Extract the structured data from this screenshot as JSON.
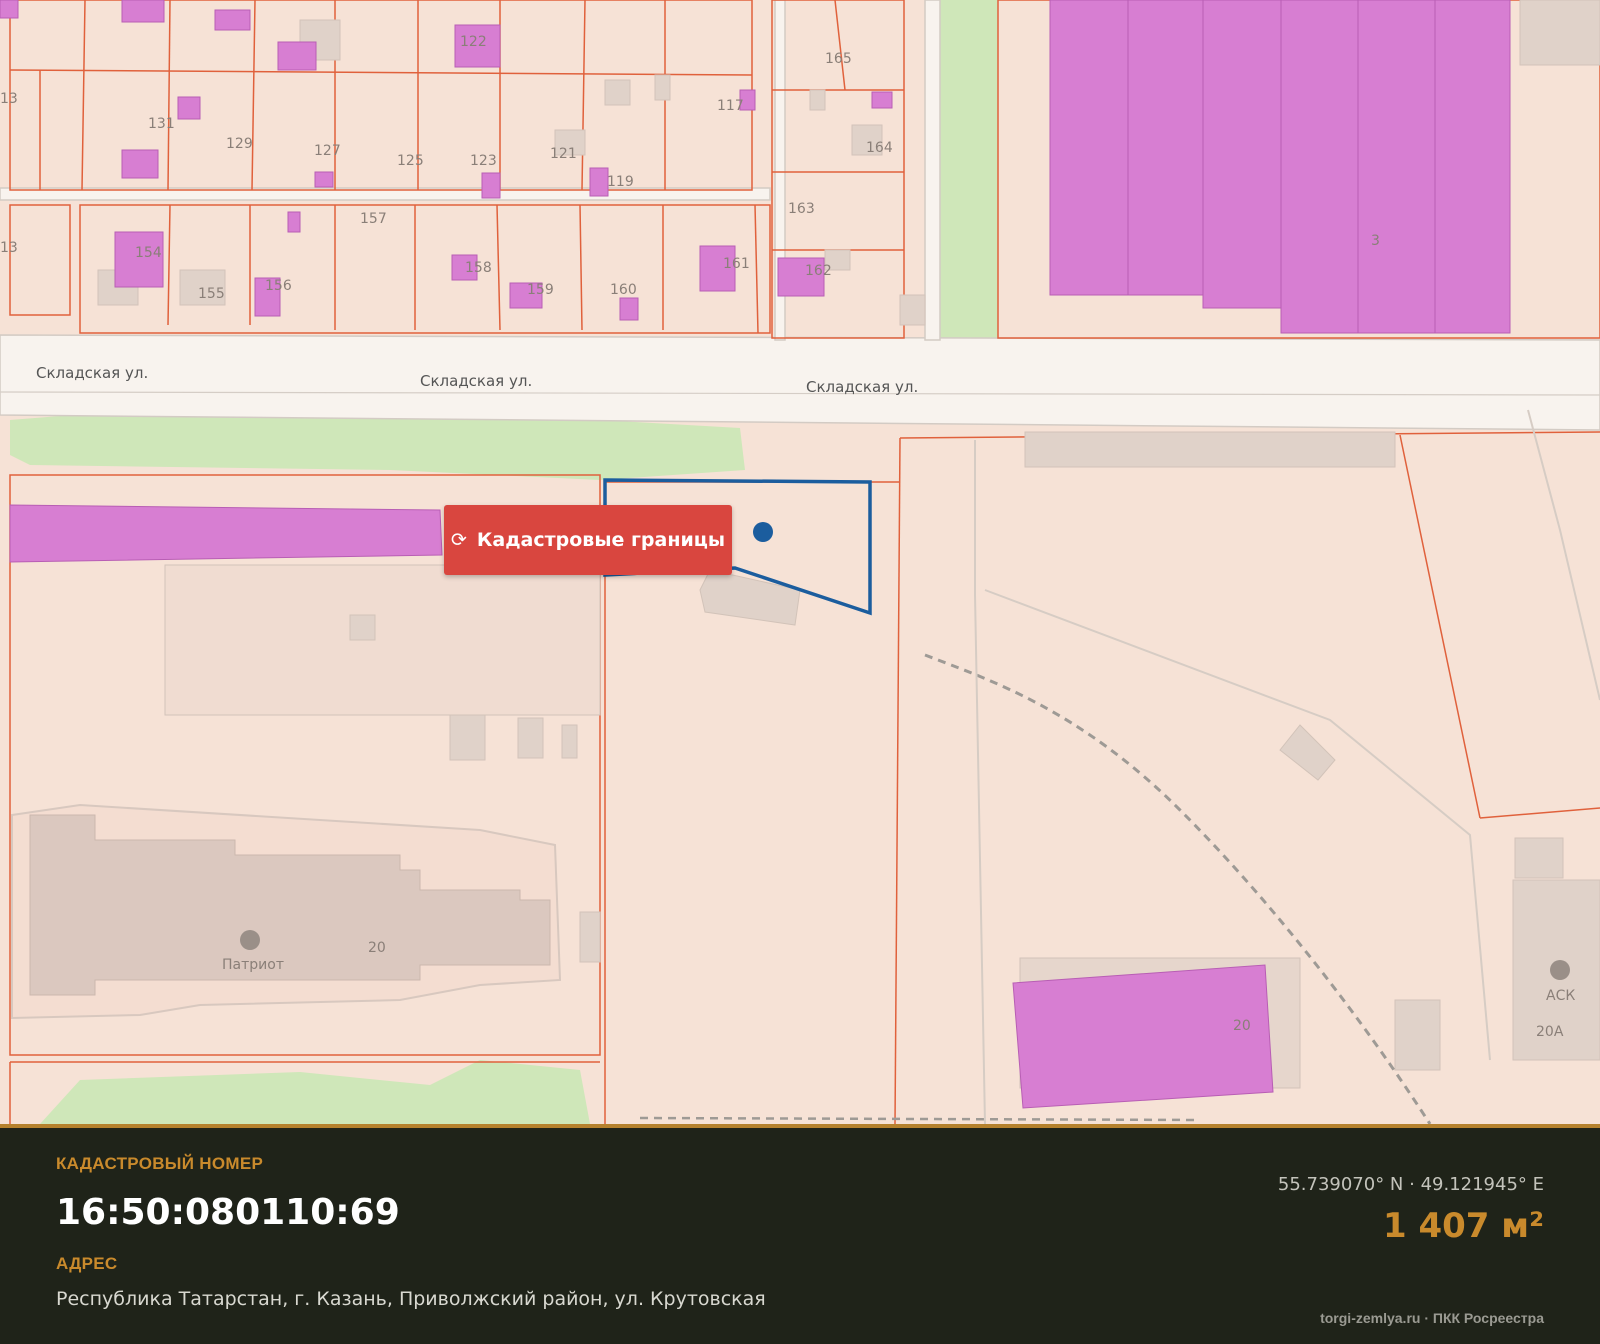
{
  "map": {
    "street_labels": [
      "Складская ул.",
      "Складская ул.",
      "Складская ул."
    ],
    "house_numbers": [
      "122",
      "165",
      "117",
      "164",
      "131",
      "129",
      "127",
      "125",
      "123",
      "121",
      "119",
      "163",
      "157",
      "154",
      "155",
      "156",
      "158",
      "159",
      "160",
      "161",
      "162",
      "3",
      "20",
      "20",
      "20А",
      "13",
      "13"
    ],
    "poi_labels": [
      "Патриот",
      "АСК"
    ],
    "colors": {
      "land": "#f6e2d6",
      "building": "#d77ed2",
      "parcel_line": "#e0613c",
      "selected_parcel": "#1b5d9e",
      "green": "#cfe7b9",
      "road": "#f8f3ee"
    }
  },
  "cadastral_button": {
    "icon": "refresh-icon",
    "label": "Кадастровые границы"
  },
  "info": {
    "cadastral_caption": "КАДАСТРОВЫЙ НОМЕР",
    "cadastral_number": "16:50:080110:69",
    "address_caption": "АДРЕС",
    "address": "Республика Татарстан, г. Казань, Приволжский район, ул. Крутовская",
    "coordinates": "55.739070° N · 49.121945° E",
    "area": "1 407 м²",
    "credit": "torgi-zemlya.ru · ПКК Росреестра"
  }
}
